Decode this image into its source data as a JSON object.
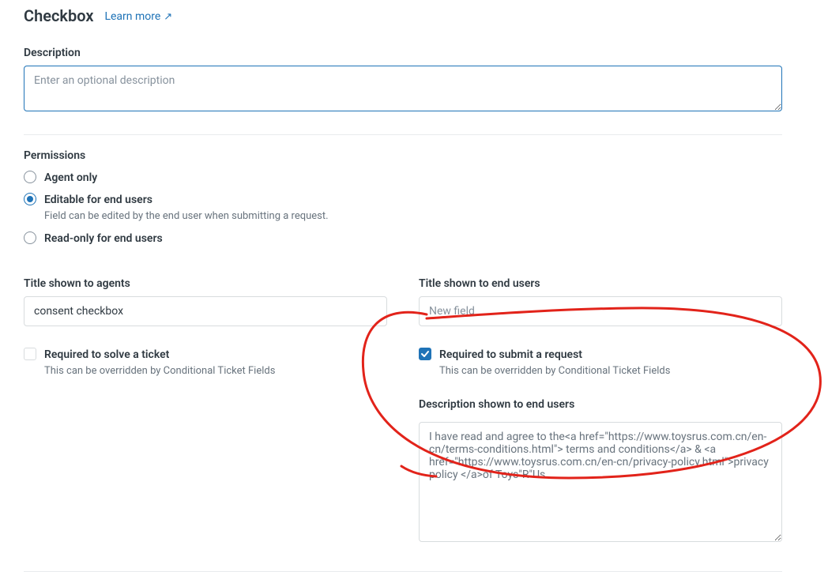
{
  "header": {
    "title": "Checkbox",
    "learn_more_label": "Learn more",
    "learn_more_icon": "↗"
  },
  "description": {
    "label": "Description",
    "value": "",
    "placeholder": "Enter an optional description"
  },
  "permissions": {
    "label": "Permissions",
    "options": [
      {
        "key": "agent_only",
        "label": "Agent only",
        "checked": false
      },
      {
        "key": "editable_end_users",
        "label": "Editable for end users",
        "checked": true,
        "help": "Field can be edited by the end user when submitting a request."
      },
      {
        "key": "read_only_end_users",
        "label": "Read-only for end users",
        "checked": false
      }
    ]
  },
  "agent_title": {
    "label": "Title shown to agents",
    "value": "consent checkbox"
  },
  "enduser_title": {
    "label": "Title shown to end users",
    "value": "",
    "placeholder": "New field"
  },
  "require_solve": {
    "label": "Required to solve a ticket",
    "help": "This can be overridden by Conditional Ticket Fields",
    "checked": false
  },
  "require_submit": {
    "label": "Required to submit a request",
    "help": "This can be overridden by Conditional Ticket Fields",
    "checked": true
  },
  "enduser_description": {
    "label": "Description shown to end users",
    "value": "I have read and agree to the<a href=\"https://www.toysrus.com.cn/en-cn/terms-conditions.html\"> terms and conditions</a> & <a href=\"https://www.toysrus.com.cn/en-cn/privacy-policy.html\">privacy policy </a>of Toys\"R\"Us."
  },
  "annotation": {
    "stroke": "#e2231a",
    "width": 3
  }
}
